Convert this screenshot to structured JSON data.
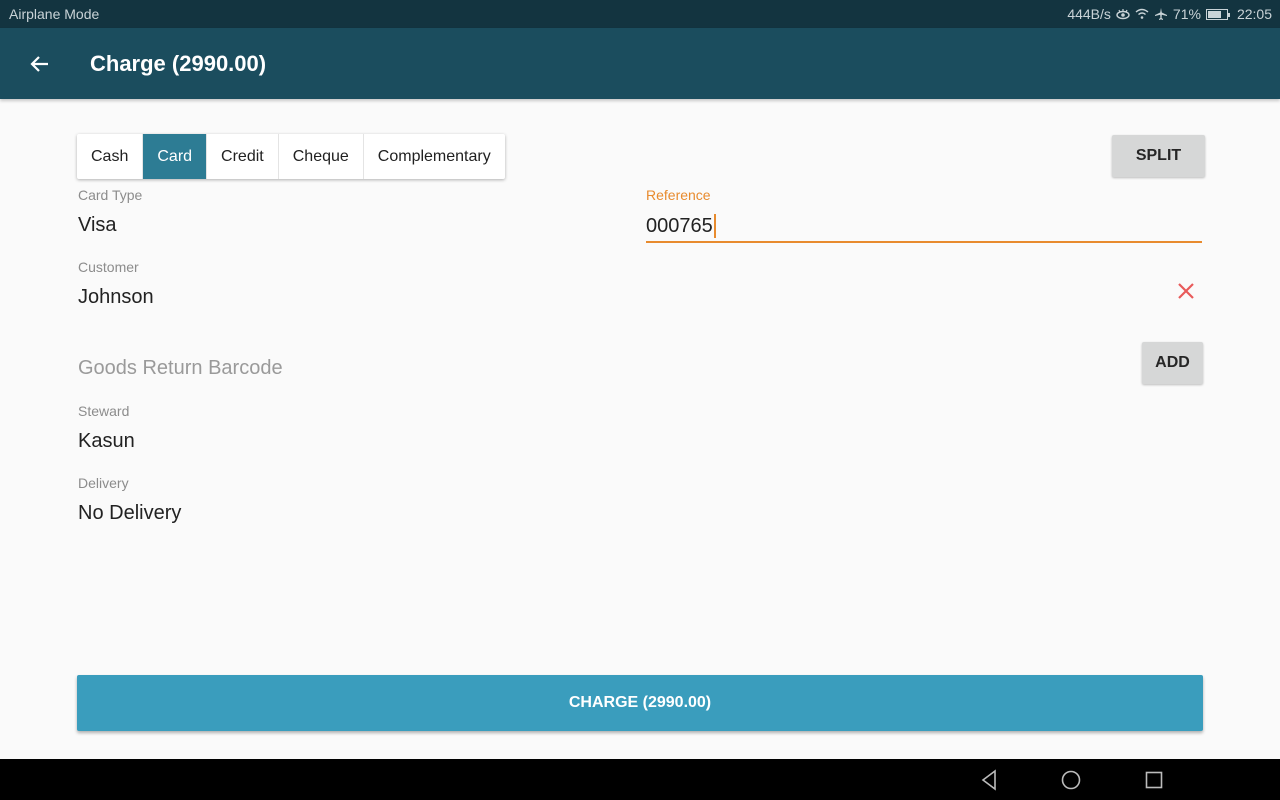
{
  "status_bar": {
    "left_text": "Airplane Mode",
    "net_speed": "444B/s",
    "battery_percent": "71%",
    "battery_level": 0.71,
    "time": "22:05",
    "icons": [
      "eye-icon",
      "wifi-icon",
      "airplane-icon",
      "battery-icon"
    ]
  },
  "app_bar": {
    "back_icon": "arrow-left-icon",
    "title": "Charge (2990.00)"
  },
  "payment_tabs": {
    "items": [
      {
        "label": "Cash",
        "active": false
      },
      {
        "label": "Card",
        "active": true
      },
      {
        "label": "Credit",
        "active": false
      },
      {
        "label": "Cheque",
        "active": false
      },
      {
        "label": "Complementary",
        "active": false
      }
    ]
  },
  "split_button": {
    "label": "SPLIT"
  },
  "form": {
    "card_type": {
      "label": "Card Type",
      "value": "Visa"
    },
    "reference": {
      "label": "Reference",
      "value": "000765"
    },
    "customer": {
      "label": "Customer",
      "value": "Johnson",
      "clear_icon": "close-icon"
    },
    "goods_return": {
      "placeholder": "Goods Return Barcode",
      "add_label": "ADD"
    },
    "steward": {
      "label": "Steward",
      "value": "Kasun"
    },
    "delivery": {
      "label": "Delivery",
      "value": "No Delivery"
    }
  },
  "charge_button": {
    "label": "CHARGE (2990.00)"
  },
  "colors": {
    "app_bar": "#1b4d5e",
    "status_bar": "#133440",
    "tab_active": "#2d7c94",
    "focus_accent": "#e88b2e",
    "charge_button": "#3a9dbd",
    "clear_icon": "#e85a5a"
  },
  "nav_bar": {
    "back": "nav-back-icon",
    "home": "nav-home-icon",
    "recents": "nav-recents-icon"
  }
}
